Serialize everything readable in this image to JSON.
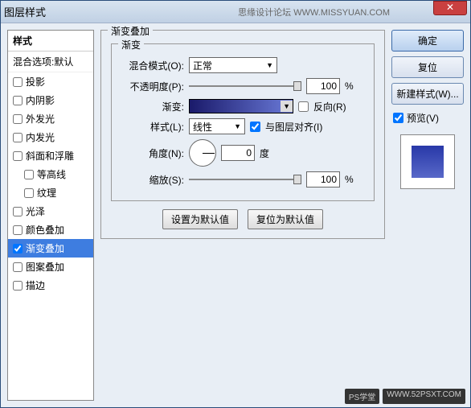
{
  "title": "图层样式",
  "titlebar_right": "思缘设计论坛  WWW.MISSYUAN.COM",
  "styles_header": "样式",
  "styles_subheader": "混合选项:默认",
  "style_items": [
    {
      "label": "投影",
      "checked": false
    },
    {
      "label": "内阴影",
      "checked": false
    },
    {
      "label": "外发光",
      "checked": false
    },
    {
      "label": "内发光",
      "checked": false
    },
    {
      "label": "斜面和浮雕",
      "checked": false
    },
    {
      "label": "等高线",
      "checked": false,
      "indent": true
    },
    {
      "label": "纹理",
      "checked": false,
      "indent": true
    },
    {
      "label": "光泽",
      "checked": false
    },
    {
      "label": "颜色叠加",
      "checked": false
    },
    {
      "label": "渐变叠加",
      "checked": true,
      "selected": true
    },
    {
      "label": "图案叠加",
      "checked": false
    },
    {
      "label": "描边",
      "checked": false
    }
  ],
  "panel_title": "渐变叠加",
  "sub_panel_title": "渐变",
  "labels": {
    "blend_mode": "混合模式(O):",
    "opacity": "不透明度(P):",
    "gradient": "渐变:",
    "reverse": "反向(R)",
    "style": "样式(L):",
    "align": "与图层对齐(I)",
    "angle": "角度(N):",
    "degree": "度",
    "scale": "缩放(S):",
    "percent": "%"
  },
  "values": {
    "blend_mode": "正常",
    "opacity": "100",
    "style": "线性",
    "angle": "0",
    "scale": "100",
    "reverse_checked": false,
    "align_checked": true
  },
  "buttons": {
    "set_default": "设置为默认值",
    "reset_default": "复位为默认值",
    "ok": "确定",
    "cancel": "复位",
    "new_style": "新建样式(W)...",
    "preview": "预览(V)"
  },
  "preview_checked": true,
  "watermark": {
    "a": "PS学堂",
    "b": "WWW.52PSXT.COM"
  }
}
